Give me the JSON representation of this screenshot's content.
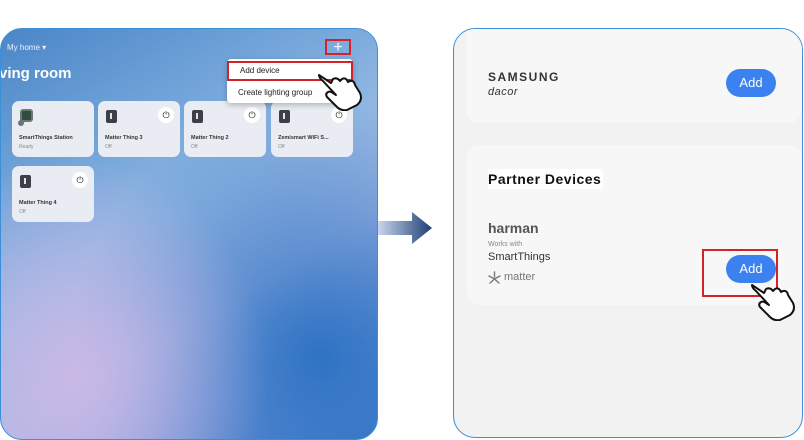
{
  "left_panel": {
    "home_selector": "My home ▾",
    "room_title": "ving room",
    "add_icon": "plus-icon",
    "menu": [
      {
        "label": "Add device"
      },
      {
        "label": "Create lighting group"
      }
    ],
    "devices": [
      {
        "name": "SmartThings Station",
        "status": "Ready",
        "icon": "station-icon",
        "power": false
      },
      {
        "name": "Matter Thing 3",
        "status": "Off",
        "icon": "plug-icon",
        "power": true
      },
      {
        "name": "Matter Thing 2",
        "status": "Off",
        "icon": "plug-icon",
        "power": true
      },
      {
        "name": "Zemismart WiFi S...",
        "status": "Off",
        "icon": "plug-icon",
        "power": true
      },
      {
        "name": "Matter Thing 4",
        "status": "Off",
        "icon": "plug-icon",
        "power": true
      }
    ]
  },
  "right_panel": {
    "samsung_brand": "SAMSUNG",
    "dacor_brand": "dacor",
    "add_label": "Add",
    "partner_title": "Partner Devices",
    "harman_brand": "harman",
    "works_with": "Works with",
    "smartthings_label": "SmartThings",
    "matter_label": "matter",
    "partner_add_label": "Add"
  },
  "colors": {
    "accent_blue": "#3b82f0",
    "highlight_red": "#d0232a",
    "panel_border": "#3b8fd6"
  }
}
